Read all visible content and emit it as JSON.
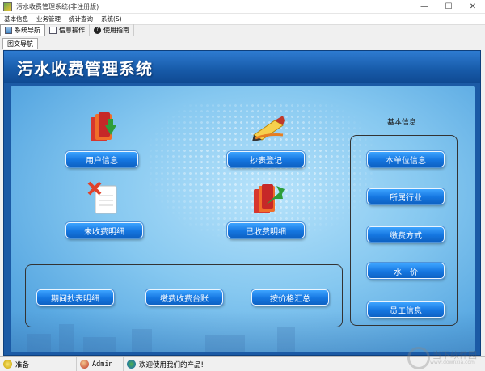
{
  "window": {
    "title": "污水收费管理系统(非注册版)",
    "minimize": "—",
    "maximize": "☐",
    "close": "✕"
  },
  "menu": [
    "基本信息",
    "业务管理",
    "统计查询",
    "系统(S)"
  ],
  "toolbar": {
    "tabs": [
      {
        "label": "系统导航",
        "icon": "navigation-icon"
      },
      {
        "label": "信息操作",
        "icon": "document-icon"
      },
      {
        "label": "使用指南",
        "icon": "help-icon"
      }
    ]
  },
  "subtab": "图文导航",
  "main": {
    "system_title": "污水收费管理系统",
    "buttons": {
      "user_info": "用户信息",
      "meter_register": "抄表登记",
      "unpaid_detail": "未收费明细",
      "paid_detail": "已收费明细",
      "period_meter_detail": "期间抄表明细",
      "payment_ledger": "缴费收费台账",
      "price_summary": "按价格汇总"
    },
    "side": {
      "title": "基本信息",
      "buttons": [
        "本单位信息",
        "所属行业",
        "缴费方式",
        "水　价",
        "员工信息"
      ]
    }
  },
  "status": {
    "ready": "准备",
    "user": "Admin",
    "message": "欢迎使用我们的产品!"
  },
  "watermark": {
    "text": "当下软件园",
    "sub": "www.downxia.com"
  }
}
